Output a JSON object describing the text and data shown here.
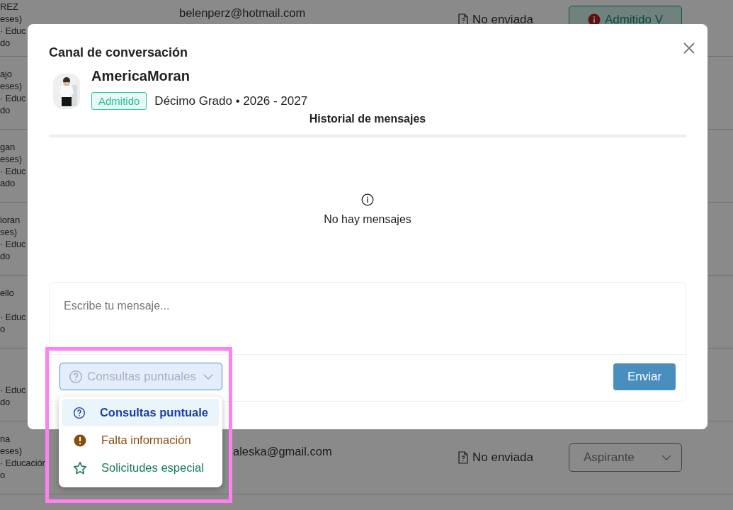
{
  "background_table": {
    "rows": [
      {
        "name": "REZ",
        "line_2": "eses)",
        "line_3": "· Educ",
        "line_4": "do",
        "email": "belenperz@hotmail.com",
        "document": "No enviada",
        "status": {
          "kind": "button",
          "label": "Admitido V"
        }
      },
      {
        "name": "ajo",
        "line_2": "eses)",
        "line_3": "· Educ",
        "line_4": "do"
      },
      {
        "name": "gan",
        "line_2": "eses)",
        "line_3": "· Educ",
        "line_4": "ado"
      },
      {
        "name": "loran",
        "line_2": "ses)",
        "line_3": "· Educ",
        "line_4": "do"
      },
      {
        "name": "ello",
        "line_3": "· Educ",
        "line_4": "o"
      },
      {
        "line_3": "· Educ",
        "line_4": "do"
      },
      {
        "name": "na",
        "line_2": "eses)",
        "line_3": "· Educación",
        "line_4": "o",
        "email": "aleska@gmail.com",
        "document": "No enviada",
        "status": {
          "kind": "select",
          "label": "Aspirante"
        }
      }
    ]
  },
  "dialog": {
    "title": "Canal de conversación",
    "contact": {
      "name": "AmericaMoran",
      "badge": "Admitido",
      "details": "Décimo Grado • 2026 - 2027"
    },
    "history": {
      "title": "Historial de mensajes",
      "empty_text": "No hay mensajes"
    },
    "composer": {
      "placeholder": "Escribe tu mensaje...",
      "category": {
        "value": "Consultas puntuales",
        "expanded": true
      },
      "options": [
        {
          "label": "Consultas puntuale",
          "kind": "question",
          "color": "#1f3fa8",
          "selected": true
        },
        {
          "label": "Falta información",
          "kind": "alert",
          "color": "#8a4b0f",
          "selected": false
        },
        {
          "label": "Solicitudes especial",
          "kind": "star",
          "color": "#157a55",
          "selected": false
        }
      ],
      "send": "Enviar"
    }
  }
}
